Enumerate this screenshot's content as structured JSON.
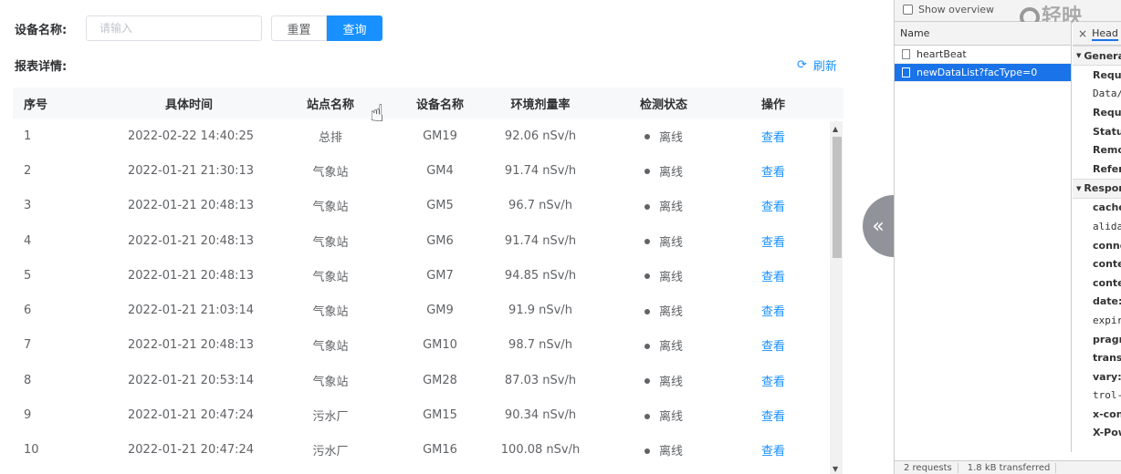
{
  "search": {
    "label": "设备名称:",
    "placeholder": "请输入",
    "value": "",
    "reset_label": "重置",
    "query_label": "查询"
  },
  "report": {
    "title": "报表详情:",
    "refresh_label": "刷新"
  },
  "table": {
    "columns": [
      "序号",
      "具体时间",
      "站点名称",
      "设备名称",
      "环境剂量率",
      "检测状态",
      "操作"
    ],
    "rows": [
      {
        "no": "1",
        "time": "2022-02-22 14:40:25",
        "station": "总排",
        "device": "GM19",
        "rate": "92.06 nSv/h",
        "status": "离线",
        "action": "查看"
      },
      {
        "no": "2",
        "time": "2022-01-21 21:30:13",
        "station": "气象站",
        "device": "GM4",
        "rate": "91.74 nSv/h",
        "status": "离线",
        "action": "查看"
      },
      {
        "no": "3",
        "time": "2022-01-21 20:48:13",
        "station": "气象站",
        "device": "GM5",
        "rate": "96.7 nSv/h",
        "status": "离线",
        "action": "查看"
      },
      {
        "no": "4",
        "time": "2022-01-21 20:48:13",
        "station": "气象站",
        "device": "GM6",
        "rate": "91.74 nSv/h",
        "status": "离线",
        "action": "查看"
      },
      {
        "no": "5",
        "time": "2022-01-21 20:48:13",
        "station": "气象站",
        "device": "GM7",
        "rate": "94.85 nSv/h",
        "status": "离线",
        "action": "查看"
      },
      {
        "no": "6",
        "time": "2022-01-21 21:03:14",
        "station": "气象站",
        "device": "GM9",
        "rate": "91.9 nSv/h",
        "status": "离线",
        "action": "查看"
      },
      {
        "no": "7",
        "time": "2022-01-21 20:48:13",
        "station": "气象站",
        "device": "GM10",
        "rate": "98.7 nSv/h",
        "status": "离线",
        "action": "查看"
      },
      {
        "no": "8",
        "time": "2022-01-21 20:53:14",
        "station": "气象站",
        "device": "GM28",
        "rate": "87.03 nSv/h",
        "status": "离线",
        "action": "查看"
      },
      {
        "no": "9",
        "time": "2022-01-21 20:47:24",
        "station": "污水厂",
        "device": "GM15",
        "rate": "90.34 nSv/h",
        "status": "离线",
        "action": "查看"
      },
      {
        "no": "10",
        "time": "2022-01-21 20:47:24",
        "station": "污水厂",
        "device": "GM16",
        "rate": "100.08 nSv/h",
        "status": "离线",
        "action": "查看"
      }
    ]
  },
  "devtools": {
    "show_overview": "Show overview",
    "watermark": "轻映",
    "name_header": "Name",
    "requests": [
      "heartBeat",
      "newDataList?facType=0"
    ],
    "selected_request": "newDataList?facType=0",
    "tab": "Head",
    "general_section": "General",
    "general_keys": [
      "Reque",
      "Data/",
      "Reque",
      "Status",
      "Remo",
      "Refer"
    ],
    "response_section": "Respon",
    "response_keys": [
      "cache",
      "alida",
      "conne",
      "conte",
      "conte",
      "date:",
      "expire",
      "pragm",
      "transf",
      "vary:",
      "trol-",
      "x-con",
      "X-Pow"
    ],
    "status_requests": "2 requests",
    "status_transferred": "1.8 kB transferred"
  },
  "colors": {
    "accent": "#1890ff",
    "devtools_selection": "#1a73e8"
  }
}
